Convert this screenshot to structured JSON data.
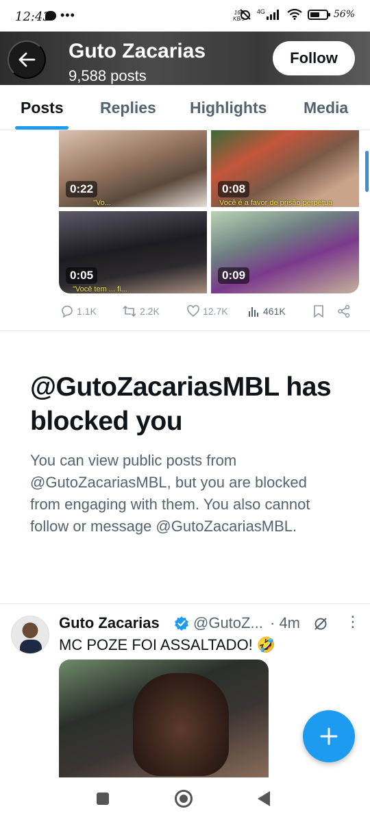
{
  "status_bar": {
    "time": "12:43",
    "speed_value": "166",
    "speed_unit": "KB/s",
    "network": "4G",
    "battery": "56%"
  },
  "header": {
    "name": "Guto Zacarias",
    "posts_count": "9,588 posts",
    "follow_label": "Follow"
  },
  "tabs": [
    {
      "label": "Posts",
      "active": true
    },
    {
      "label": "Replies",
      "active": false
    },
    {
      "label": "Highlights",
      "active": false
    },
    {
      "label": "Media",
      "active": false
    }
  ],
  "media_grid": [
    {
      "duration": "0:22",
      "caption": "\"Vo..."
    },
    {
      "duration": "0:08",
      "caption": "Você é a favor de prisão perpétua"
    },
    {
      "duration": "0:05",
      "caption": "\"Você tem ... fi..."
    },
    {
      "duration": "0:09",
      "caption": ""
    }
  ],
  "post_actions": {
    "replies": "1.1K",
    "reposts": "2.2K",
    "likes": "12.7K",
    "views": "461K"
  },
  "blocked": {
    "title": "@GutoZacariasMBL has blocked you",
    "description": "You can view public posts from @GutoZacariasMBL, but you are blocked from engaging with them. You also cannot follow or message @GutoZacariasMBL."
  },
  "tweet": {
    "name": "Guto Zacarias",
    "handle": "@GutoZ...",
    "time": "· 4m",
    "text": "MC POZE FOI ASSALTADO! 🤣"
  },
  "colors": {
    "accent": "#1d9bf0",
    "text_primary": "#0f1419",
    "text_secondary": "#536471"
  }
}
